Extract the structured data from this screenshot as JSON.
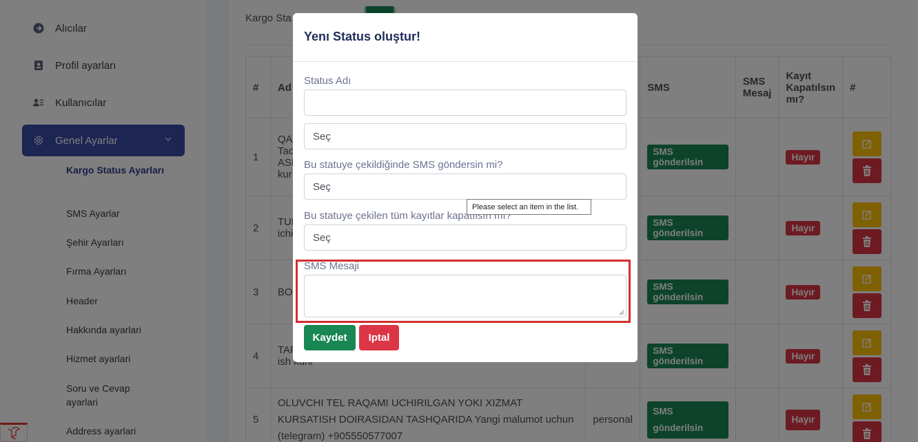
{
  "sidebar": {
    "items": [
      {
        "label": "Alıcılar",
        "icon": "arrow-circle-right-icon"
      },
      {
        "label": "Profil ayarları",
        "icon": "id-card-icon"
      },
      {
        "label": "Kullanıcılar",
        "icon": "users-list-icon"
      },
      {
        "label": "Genel Ayarlar",
        "icon": "gear-icon",
        "active": true
      }
    ],
    "sub_items": [
      "Kargo Status Ayarları",
      "SMS Ayarlar",
      "Şehir Ayarları",
      "Fırma Ayarları",
      "Header",
      "Hakkında ayarlari",
      "Hizmet ayarlari",
      "Soru ve Cevap ayarlari",
      "Address ayarlari"
    ]
  },
  "page": {
    "title_partial": "Kargo Sta"
  },
  "table": {
    "headers": [
      "#",
      "Ad",
      "SMS",
      "SMS Mesaj",
      "Kayıt Kapatılsın mı?",
      "#"
    ],
    "rows": [
      {
        "num": "1",
        "ad": "QA\nTac\nASH\nkur",
        "sms": "SMS gönderilsin",
        "kapat": "Hayır"
      },
      {
        "num": "2",
        "ad": "TUH\nichi",
        "sms": "SMS gönderilsin",
        "kapat": "Hayır"
      },
      {
        "num": "3",
        "ad": "BO.",
        "sms": "SMS gönderilsin",
        "kapat": "Hayır"
      },
      {
        "num": "4",
        "ad": "TAF\nish kuni",
        "sms": "SMS gönderilsin",
        "kapat": "Hayır"
      },
      {
        "num": "5",
        "ad": "OLUVCHI TEL RAQAMI UCHIRILGAN YOKI XIZMAT KURSATISH DOIRASIDAN TASHQARIDA Yangi malumot uchun (telegram) +905550577007",
        "type": "personal",
        "sms": "SMS gönderilsin",
        "kapat": "Hayır"
      }
    ]
  },
  "modal": {
    "title": "Yenı Status oluştur!",
    "status_label": "Status Adı",
    "status_value": "",
    "select1_value": "Seç",
    "sms_question": "Bu statuye çekildiğinde SMS göndersin mi?",
    "select2_value": "Seç",
    "close_question": "Bu statuye çekilen tüm kayıtlar kapatılsın mı?",
    "select3_value": "Seç",
    "sms_message_label": "SMS Mesaji",
    "save_label": "Kaydet",
    "cancel_label": "Iptal"
  },
  "tooltip": "Please select an item in the list.",
  "colors": {
    "accent": "#3b4ba6",
    "success": "#198754",
    "danger": "#dc3545",
    "warning": "#ffc107",
    "highlight": "#d32f2f"
  }
}
